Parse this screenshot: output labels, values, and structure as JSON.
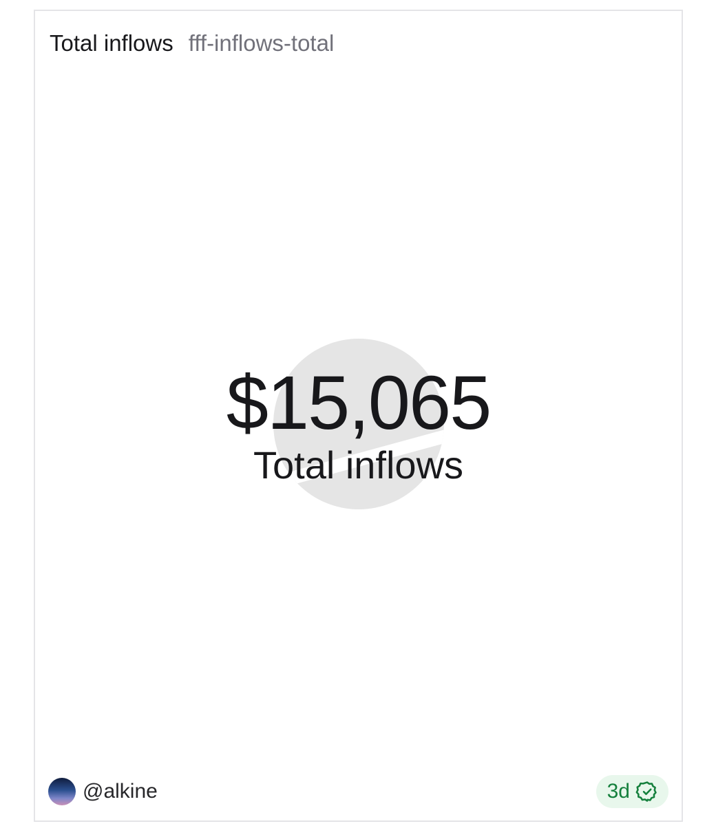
{
  "card": {
    "title": "Total inflows",
    "slug": "fff-inflows-total"
  },
  "metric": {
    "value": "$15,065",
    "label": "Total inflows"
  },
  "footer": {
    "author_handle": "@alkine",
    "age": "3d",
    "status_icon": "verified-badge-icon"
  },
  "colors": {
    "text_primary": "#18181b",
    "text_secondary": "#71717a",
    "badge_bg": "#e8f7ec",
    "badge_fg": "#15803d",
    "watermark": "#e5e5e5"
  }
}
